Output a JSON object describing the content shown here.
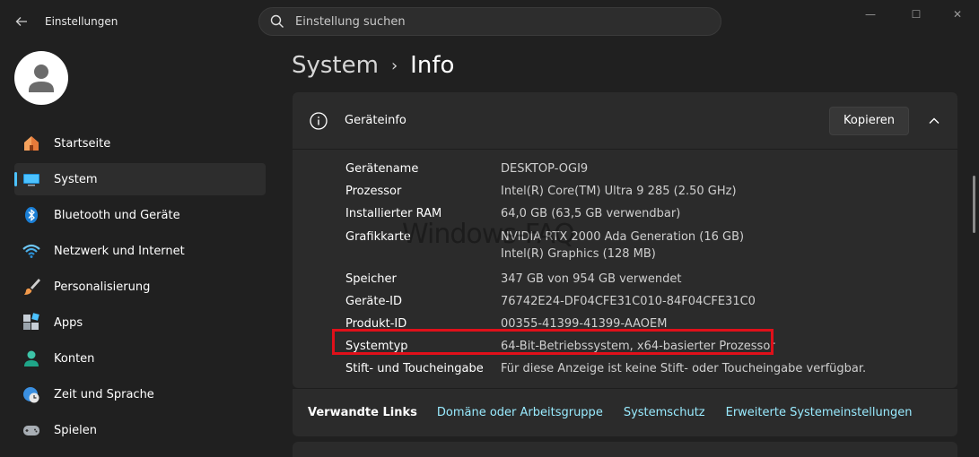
{
  "window": {
    "title": "Einstellungen",
    "controls": {
      "minimize": "—",
      "maximize": "☐",
      "close": "✕"
    }
  },
  "search": {
    "placeholder": "Einstellung suchen",
    "value": ""
  },
  "sidebar": {
    "items": [
      {
        "label": "Startseite",
        "icon": "home-icon",
        "active": false
      },
      {
        "label": "System",
        "icon": "monitor-icon",
        "active": true
      },
      {
        "label": "Bluetooth und Geräte",
        "icon": "bluetooth-icon",
        "active": false
      },
      {
        "label": "Netzwerk und Internet",
        "icon": "wifi-icon",
        "active": false
      },
      {
        "label": "Personalisierung",
        "icon": "brush-icon",
        "active": false
      },
      {
        "label": "Apps",
        "icon": "apps-icon",
        "active": false
      },
      {
        "label": "Konten",
        "icon": "person-icon",
        "active": false
      },
      {
        "label": "Zeit und Sprache",
        "icon": "clock-globe-icon",
        "active": false
      },
      {
        "label": "Spielen",
        "icon": "gamepad-icon",
        "active": false
      }
    ]
  },
  "breadcrumb": {
    "parent": "System",
    "separator": "›",
    "current": "Info"
  },
  "device_card": {
    "title": "Geräteinfo",
    "copy_button": "Kopieren",
    "specs": [
      {
        "label": "Gerätename",
        "value": "DESKTOP-OGI9"
      },
      {
        "label": "Prozessor",
        "value": "Intel(R) Core(TM) Ultra 9 285 (2.50 GHz)"
      },
      {
        "label": "Installierter RAM",
        "value": "64,0 GB (63,5 GB verwendbar)"
      },
      {
        "label": "Grafikkarte",
        "value": "NVIDIA RTX 2000 Ada Generation (16 GB)",
        "value2": "Intel(R) Graphics (128 MB)"
      },
      {
        "label": "Speicher",
        "value": "347 GB von 954 GB verwendet"
      },
      {
        "label": "Geräte-ID",
        "value": "76742E24-DF04CFE31C010-84F04CFE31C0"
      },
      {
        "label": "Produkt-ID",
        "value": "00355-41399-41399-AAOEM"
      },
      {
        "label": "Systemtyp",
        "value": "64-Bit-Betriebssystem, x64-basierter Prozessor"
      },
      {
        "label": "Stift- und Toucheingabe",
        "value": "Für diese Anzeige ist keine Stift- oder Toucheingabe verfügbar."
      }
    ]
  },
  "related": {
    "title": "Verwandte Links",
    "links": [
      "Domäne oder Arbeitsgruppe",
      "Systemschutz",
      "Erweiterte Systemeinstellungen"
    ]
  },
  "watermark": "Windows-FAQ",
  "colors": {
    "accent": "#4cc2ff",
    "link": "#99ebff",
    "highlight": "#e0101a",
    "background": "#202020",
    "card": "#2b2b2b"
  }
}
